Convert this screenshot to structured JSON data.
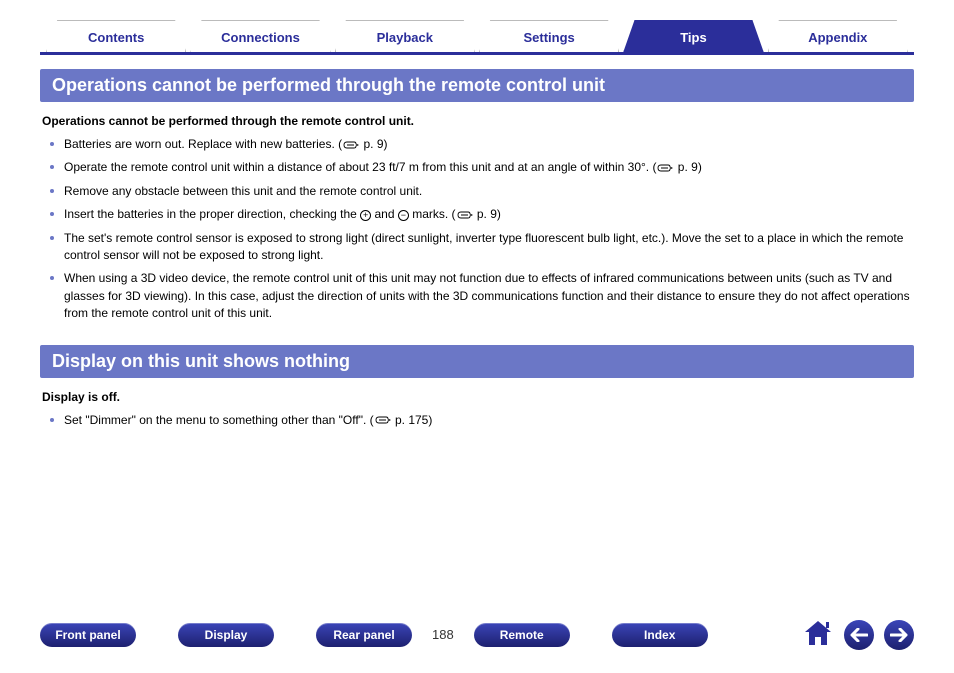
{
  "tabs": [
    {
      "label": "Contents",
      "active": false
    },
    {
      "label": "Connections",
      "active": false
    },
    {
      "label": "Playback",
      "active": false
    },
    {
      "label": "Settings",
      "active": false
    },
    {
      "label": "Tips",
      "active": true
    },
    {
      "label": "Appendix",
      "active": false
    }
  ],
  "section1": {
    "title": "Operations cannot be performed through the remote control unit",
    "subheading": "Operations cannot be performed through the remote control unit.",
    "items": [
      {
        "text_a": "Batteries are worn out. Replace with new batteries.  (",
        "ref": " p. 9)"
      },
      {
        "text_a": "Operate the remote control unit within a distance of about 23 ft/7 m from this unit and at an angle of within 30°.  (",
        "ref": " p. 9)"
      },
      {
        "text_a": "Remove any obstacle between this unit and the remote control unit."
      },
      {
        "text_a": "Insert the batteries in the proper direction, checking the ",
        "polarity": true,
        "text_b": " marks.  (",
        "ref": " p. 9)"
      },
      {
        "text_a": "The set's remote control sensor is exposed to strong light (direct sunlight, inverter type fluorescent bulb light, etc.). Move the set to a place in which the remote control sensor will not be exposed to strong light."
      },
      {
        "text_a": "When using a 3D video device, the remote control unit of this unit may not function due to effects of infrared communications between units (such as TV and glasses for 3D viewing). In this case, adjust the direction of units with the 3D communications function and their distance to ensure they do not affect operations from the remote control unit of this unit."
      }
    ]
  },
  "section2": {
    "title": "Display on this unit shows nothing",
    "subheading": "Display is off.",
    "items": [
      {
        "text_a": "Set \"Dimmer\" on the menu to something other than \"Off\".  (",
        "ref": " p. 175)"
      }
    ]
  },
  "footer": {
    "buttons": [
      "Front panel",
      "Display",
      "Rear panel"
    ],
    "page": "188",
    "buttons2": [
      "Remote",
      "Index"
    ]
  }
}
